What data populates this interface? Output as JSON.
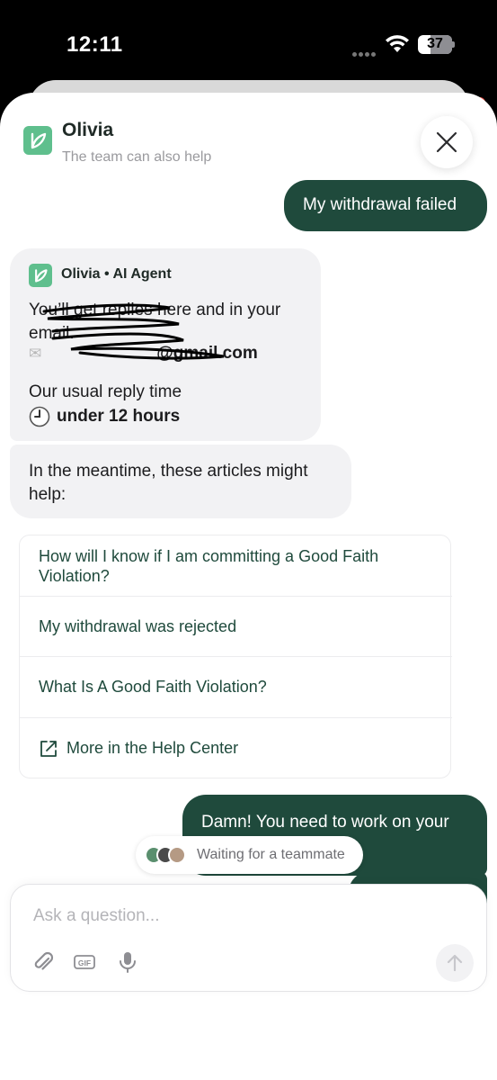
{
  "status_bar": {
    "time": "12:11",
    "battery": "37",
    "battery_level_percent": 37
  },
  "header": {
    "agent_name": "Olivia",
    "subtitle": "The team can also help",
    "close_icon": "close-icon"
  },
  "messages": {
    "user_1": "My withdrawal failed",
    "bot_header": "Olivia • AI Agent",
    "bot_intro": "You’ll get replies here and in your email:",
    "bot_email": "@gmail.com",
    "bot_reply_time_label": "Our usual reply time",
    "bot_reply_time_value": "under 12 hours",
    "bot_meantime": "In the meantime, these articles might help:",
    "user_2": "Damn! You need to work on your"
  },
  "articles": [
    "How will I know if I am committing a Good Faith Violation?",
    "My withdrawal was rejected",
    "What Is A Good Faith Violation?",
    "More in the Help Center"
  ],
  "waiting": {
    "text": "Waiting for a teammate"
  },
  "composer": {
    "placeholder": "Ask a question...",
    "gif_label": "GIF"
  },
  "colors": {
    "accent": "#1f4a3c",
    "logo": "#5fbf8d",
    "bot_bubble": "#f2f2f4"
  }
}
